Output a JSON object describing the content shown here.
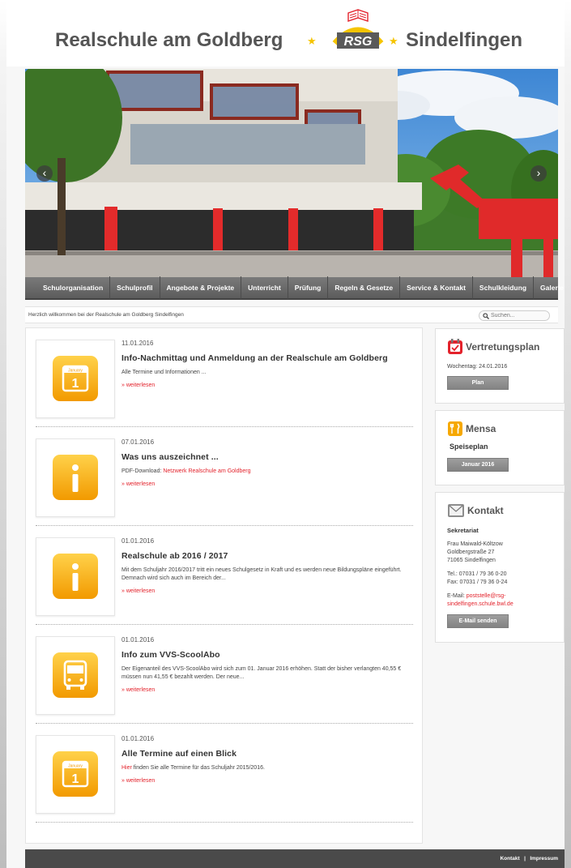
{
  "header": {
    "left_title": "Realschule am Goldberg",
    "right_title": "Sindelfingen",
    "logo_text": "RSG"
  },
  "slider": {
    "prev_icon": "chevron-left-icon",
    "next_icon": "chevron-right-icon",
    "prev_glyph": "‹",
    "next_glyph": "›"
  },
  "nav": {
    "items": [
      "Schulorganisation",
      "Schulprofil",
      "Angebote & Projekte",
      "Unterricht",
      "Prüfung",
      "Regeln & Gesetze",
      "Service & Kontakt",
      "Schulkleidung",
      "Galerie"
    ]
  },
  "welcome": {
    "text": "Herzlich willkommen bei der Realschule am Goldberg Sindelfingen",
    "search_placeholder": "Suchen..."
  },
  "news": [
    {
      "date": "11.01.2016",
      "title": "Info-Nachmittag und Anmeldung an der Realschule am Goldberg",
      "text_pre": "Alle Termine und Informationen ...",
      "link": "",
      "text_post": "",
      "more": "» weiterlesen",
      "icon": "calendar-icon"
    },
    {
      "date": "07.01.2016",
      "title": "Was uns auszeichnet ...",
      "text_pre": "PDF-Download: ",
      "link": "Netzwerk Realschule am Goldberg",
      "text_post": "",
      "more": "» weiterlesen",
      "icon": "info-icon"
    },
    {
      "date": "01.01.2016",
      "title": "Realschule ab 2016 / 2017",
      "text_pre": "Mit dem Schuljahr 2016/2017 tritt ein neues Schulgesetz in Kraft und es werden neue Bildungspläne eingeführt. Demnach wird sich auch im Bereich der...",
      "link": "",
      "text_post": "",
      "more": "» weiterlesen",
      "icon": "info-icon"
    },
    {
      "date": "01.01.2016",
      "title": "Info zum VVS-ScoolAbo",
      "text_pre": "Der Eigenanteil des VVS-ScoolAbo wird sich zum 01. Januar 2016 erhöhen. Statt der bisher verlangten 40,55 € müssen nun 41,55 € bezahlt werden. Der neue...",
      "link": "",
      "text_post": "",
      "more": "» weiterlesen",
      "icon": "bus-icon"
    },
    {
      "date": "01.01.2016",
      "title": "Alle Termine auf einen Blick",
      "text_pre": "",
      "link": "Hier",
      "text_post": " finden Sie alle Termine für das Schuljahr 2015/2016.",
      "more": "» weiterlesen",
      "icon": "calendar-icon"
    }
  ],
  "calendar_icon_text": {
    "month": "January",
    "day": "1"
  },
  "vertretungsplan": {
    "title": "Vertretungsplan",
    "line": "Wochentag: 24.01.2016",
    "button": "Plan"
  },
  "mensa": {
    "title": "Mensa",
    "subtitle": "Speiseplan",
    "button": "Januar 2016"
  },
  "kontakt": {
    "title": "Kontakt",
    "subtitle": "Sekretariat",
    "lines": [
      "Frau Maiwald-Költzow",
      "Goldbergstraße 27",
      "71065 Sindelfingen"
    ],
    "phone": "Tel.: 07031 / 79 36 0-20",
    "fax": "Fax: 07031 / 79 36 0-24",
    "email_label": "E-Mail: ",
    "email_1": "poststelle@rsg-",
    "email_2": "sindelfingen.schule.bwl.de",
    "button": "E-Mail senden"
  },
  "footer": {
    "kontakt": "Kontakt",
    "separator": "|",
    "impressum": "Impressum"
  },
  "colors": {
    "accent_red": "#e3222b",
    "icon_orange": "#f6a800",
    "nav_gray": "#666666"
  }
}
